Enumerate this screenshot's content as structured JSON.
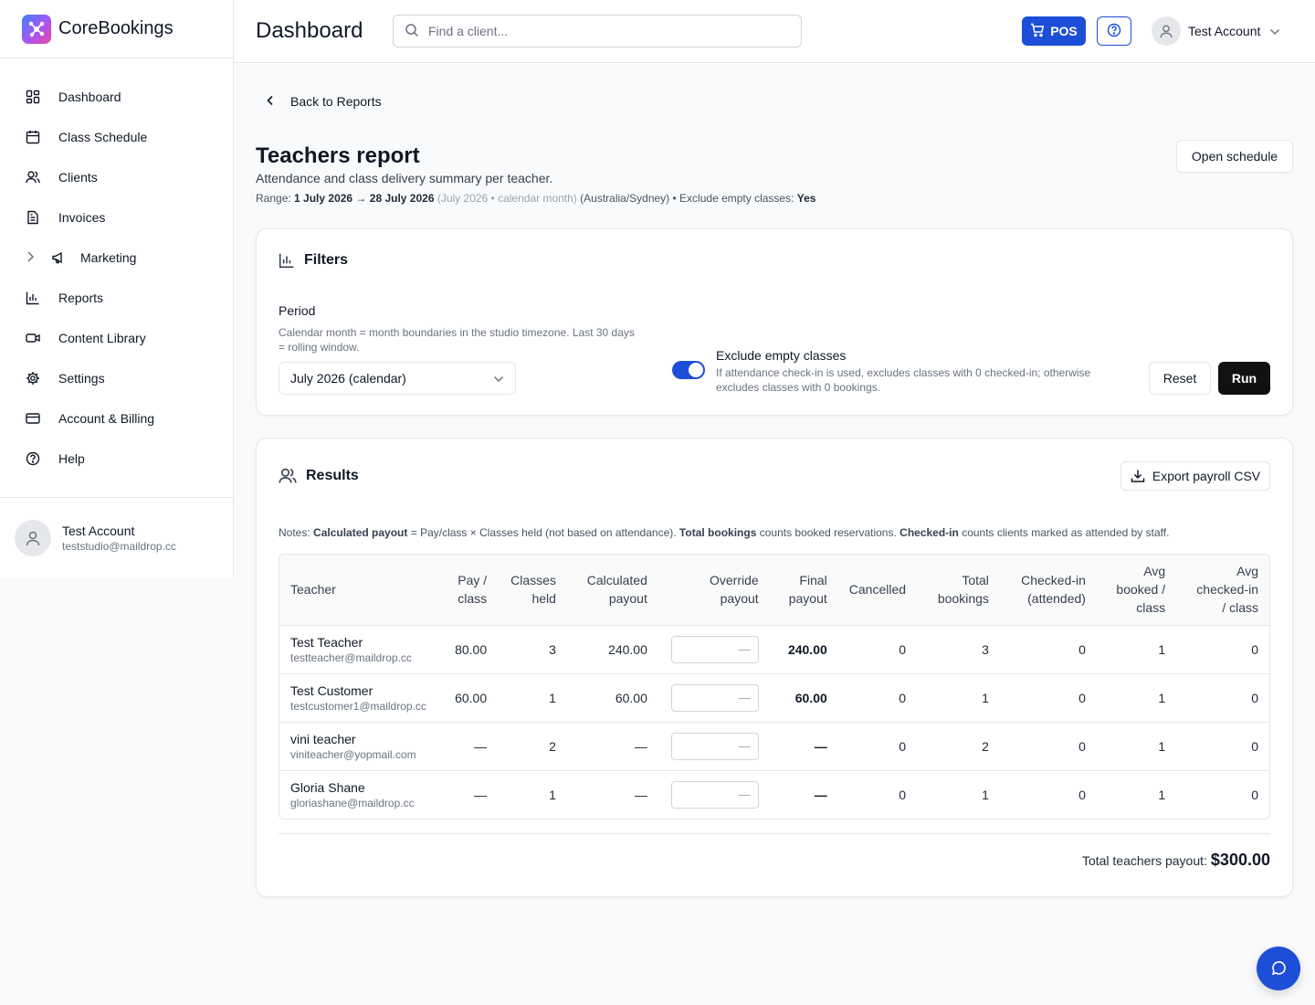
{
  "app": {
    "name": "CoreBookings"
  },
  "sidebar": {
    "items": [
      {
        "label": "Dashboard",
        "icon": "dashboard-icon"
      },
      {
        "label": "Class Schedule",
        "icon": "calendar-icon"
      },
      {
        "label": "Clients",
        "icon": "users-icon"
      },
      {
        "label": "Invoices",
        "icon": "file-icon"
      },
      {
        "label": "Marketing",
        "icon": "megaphone-icon"
      },
      {
        "label": "Reports",
        "icon": "bar-chart-icon"
      },
      {
        "label": "Content Library",
        "icon": "video-icon"
      },
      {
        "label": "Settings",
        "icon": "gear-icon"
      },
      {
        "label": "Account & Billing",
        "icon": "credit-card-icon"
      },
      {
        "label": "Help",
        "icon": "help-circle-icon"
      }
    ],
    "user": {
      "name": "Test Account",
      "email": "teststudio@maildrop.cc"
    }
  },
  "topbar": {
    "title": "Dashboard",
    "search_placeholder": "Find a client...",
    "pos_label": "POS",
    "account_name": "Test Account"
  },
  "page": {
    "back_label": "Back to Reports",
    "title": "Teachers report",
    "subtitle": "Attendance and class delivery summary per teacher.",
    "range": {
      "prefix": "Range:",
      "dates": "1 July 2026 → 28 July 2026",
      "period_note": "(July 2026 • calendar month)",
      "timezone": "(Australia/Sydney) • Exclude empty classes:",
      "exclude_value": "Yes"
    },
    "open_schedule_label": "Open schedule"
  },
  "filters": {
    "title": "Filters",
    "period_label": "Period",
    "period_help": "Calendar month = month boundaries in the studio timezone. Last 30 days = rolling window.",
    "period_value": "July 2026 (calendar)",
    "exclude_title": "Exclude empty classes",
    "exclude_help": "If attendance check-in is used, excludes classes with 0 checked-in; otherwise excludes classes with 0 bookings.",
    "exclude_on": true,
    "reset_label": "Reset",
    "run_label": "Run"
  },
  "results": {
    "title": "Results",
    "export_label": "Export payroll CSV",
    "notes": {
      "prefix": "Notes:",
      "calc_term": "Calculated payout",
      "calc_desc": "= Pay/class × Classes held (not based on attendance).",
      "bookings_term": "Total bookings",
      "bookings_desc": "counts booked reservations.",
      "checked_term": "Checked-in",
      "checked_desc": "counts clients marked as attended by staff."
    },
    "headers": {
      "teacher": "Teacher",
      "pay_1": "Pay /",
      "pay_2": "class",
      "held_1": "Classes",
      "held_2": "held",
      "calc_1": "Calculated",
      "calc_2": "payout",
      "override_1": "Override",
      "override_2": "payout",
      "final_1": "Final",
      "final_2": "payout",
      "cancelled": "Cancelled",
      "total_1": "Total",
      "total_2": "bookings",
      "checked_1": "Checked-in",
      "checked_2": "(attended)",
      "avgb_1": "Avg",
      "avgb_2": "booked /",
      "avgb_3": "class",
      "avgc_1": "Avg",
      "avgc_2": "checked-in",
      "avgc_3": "/ class"
    },
    "override_placeholder": "—",
    "rows": [
      {
        "name": "Test Teacher",
        "email": "testteacher@maildrop.cc",
        "pay": "80.00",
        "held": "3",
        "calc": "240.00",
        "final": "240.00",
        "cancelled": "0",
        "total": "3",
        "checked": "0",
        "avg_booked": "1",
        "avg_checked": "0"
      },
      {
        "name": "Test Customer",
        "email": "testcustomer1@maildrop.cc",
        "pay": "60.00",
        "held": "1",
        "calc": "60.00",
        "final": "60.00",
        "cancelled": "0",
        "total": "1",
        "checked": "0",
        "avg_booked": "1",
        "avg_checked": "0"
      },
      {
        "name": "vini teacher",
        "email": "viniteacher@yopmail.com",
        "pay": "—",
        "held": "2",
        "calc": "—",
        "final": "—",
        "cancelled": "0",
        "total": "2",
        "checked": "0",
        "avg_booked": "1",
        "avg_checked": "0"
      },
      {
        "name": "Gloria Shane",
        "email": "gloriashane@maildrop.cc",
        "pay": "—",
        "held": "1",
        "calc": "—",
        "final": "—",
        "cancelled": "0",
        "total": "1",
        "checked": "0",
        "avg_booked": "1",
        "avg_checked": "0"
      }
    ],
    "total_label": "Total teachers payout:",
    "total_value": "$300.00"
  },
  "colors": {
    "primary": "#1d4ed8",
    "run": "#111111"
  }
}
